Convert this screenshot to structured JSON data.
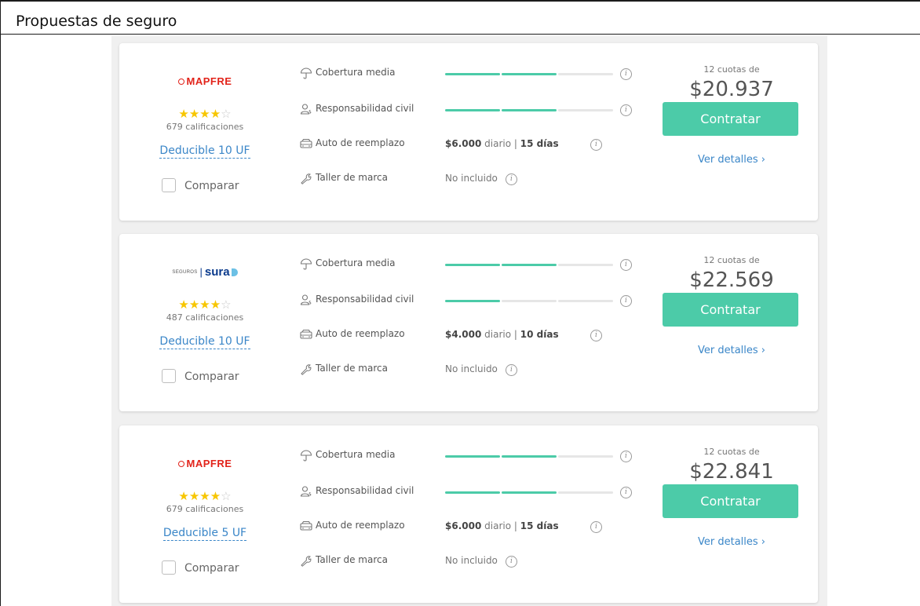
{
  "document": {
    "title": "Propuestas de seguro"
  },
  "colors": {
    "accent": "#4ccba8",
    "link": "#3a86c8",
    "star": "#f7c600",
    "mapfre": "#e2231a",
    "sura": "#0a3a8c"
  },
  "labels": {
    "coverage": "Cobertura media",
    "liability": "Responsabilidad civil",
    "replacement": "Auto de reemplazo",
    "workshop": "Taller de marca",
    "compare": "Comparar",
    "installments": "12 cuotas de",
    "hire": "Contratar",
    "details": "Ver detalles ›",
    "daily": "diario",
    "sep": "|",
    "info": "i"
  },
  "icons": {
    "coverage": "umbrella-icon",
    "liability": "user-dollar-icon",
    "replacement": "car-icon",
    "workshop": "wrench-icon",
    "info": "info-icon",
    "checkbox": "checkbox-icon"
  },
  "offers": [
    {
      "insurer": "MAPFRE",
      "logo_text": "MAPFRE",
      "rating": 3.5,
      "stars": "★★★",
      "star_half": "★",
      "star_off": "☆",
      "ratings_count": "679 calificaciones",
      "deductible": "Deducible 10 UF",
      "coverage_level": 2,
      "liability_level": 2,
      "replacement_amount": "$6.000",
      "replacement_days": "15 días",
      "workshop": "No incluido",
      "price": "$20.937"
    },
    {
      "insurer": "SURA",
      "logo_small": "SEGUROS",
      "logo_bar": "|",
      "logo_text": "sura",
      "rating": 3.5,
      "stars": "★★★",
      "star_half": "★",
      "star_off": "☆",
      "ratings_count": "487 calificaciones",
      "deductible": "Deducible 10 UF",
      "coverage_level": 2,
      "liability_level": 1,
      "replacement_amount": "$4.000",
      "replacement_days": "10 días",
      "workshop": "No incluido",
      "price": "$22.569"
    },
    {
      "insurer": "MAPFRE",
      "logo_text": "MAPFRE",
      "rating": 3.5,
      "stars": "★★★",
      "star_half": "★",
      "star_off": "☆",
      "ratings_count": "679 calificaciones",
      "deductible": "Deducible 5 UF",
      "coverage_level": 2,
      "liability_level": 2,
      "replacement_amount": "$6.000",
      "replacement_days": "15 días",
      "workshop": "No incluido",
      "price": "$22.841"
    }
  ]
}
